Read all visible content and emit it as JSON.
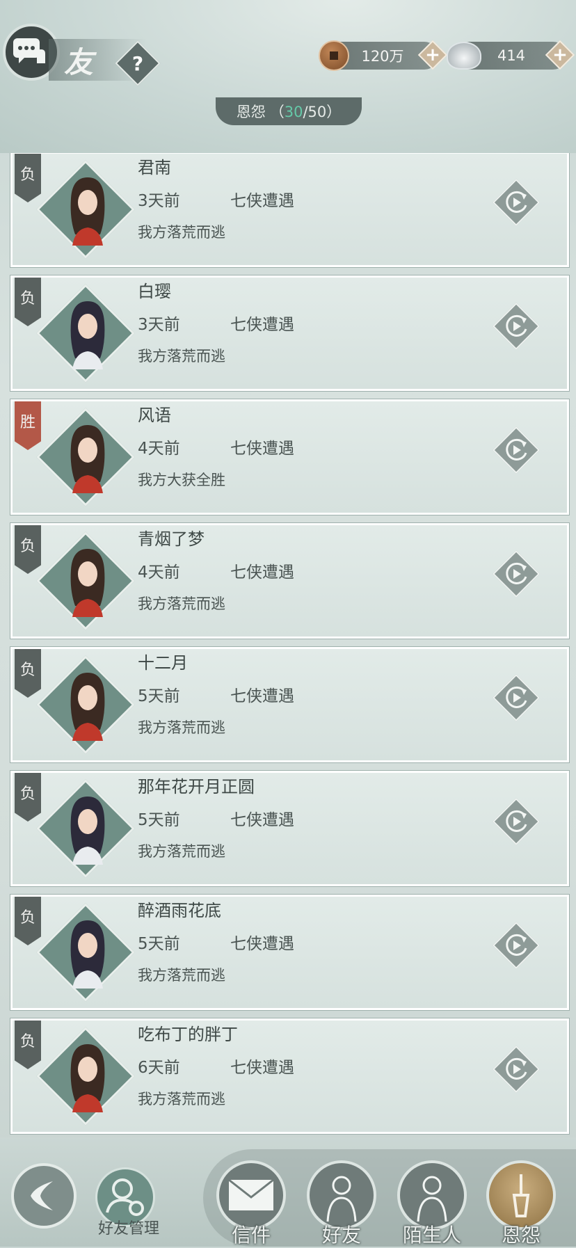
{
  "header": {
    "title": "友",
    "help_label": "?",
    "coins": "120万",
    "silver": "414",
    "plus": "+"
  },
  "tab": {
    "label": "恩怨",
    "open": "（",
    "current": "30",
    "sep": "/",
    "max": "50",
    "close": "）"
  },
  "records": [
    {
      "tag": "负",
      "win": false,
      "name": "君南",
      "time": "3天前",
      "mode": "七侠遭遇",
      "result": "我方落荒而逃",
      "gender": "m"
    },
    {
      "tag": "负",
      "win": false,
      "name": "白璎",
      "time": "3天前",
      "mode": "七侠遭遇",
      "result": "我方落荒而逃",
      "gender": "f"
    },
    {
      "tag": "胜",
      "win": true,
      "name": "风语",
      "time": "4天前",
      "mode": "七侠遭遇",
      "result": "我方大获全胜",
      "gender": "m"
    },
    {
      "tag": "负",
      "win": false,
      "name": "青烟了梦",
      "time": "4天前",
      "mode": "七侠遭遇",
      "result": "我方落荒而逃",
      "gender": "m"
    },
    {
      "tag": "负",
      "win": false,
      "name": "十二月",
      "time": "5天前",
      "mode": "七侠遭遇",
      "result": "我方落荒而逃",
      "gender": "m"
    },
    {
      "tag": "负",
      "win": false,
      "name": "那年花开月正圆",
      "time": "5天前",
      "mode": "七侠遭遇",
      "result": "我方落荒而逃",
      "gender": "f"
    },
    {
      "tag": "负",
      "win": false,
      "name": "醉酒雨花底",
      "time": "5天前",
      "mode": "七侠遭遇",
      "result": "我方落荒而逃",
      "gender": "f"
    },
    {
      "tag": "负",
      "win": false,
      "name": "吃布丁的胖丁",
      "time": "6天前",
      "mode": "七侠遭遇",
      "result": "我方落荒而逃",
      "gender": "m"
    }
  ],
  "bottom": {
    "manage_label": "好友管理",
    "nav": [
      "信件",
      "好友",
      "陌生人",
      "恩怨"
    ]
  }
}
